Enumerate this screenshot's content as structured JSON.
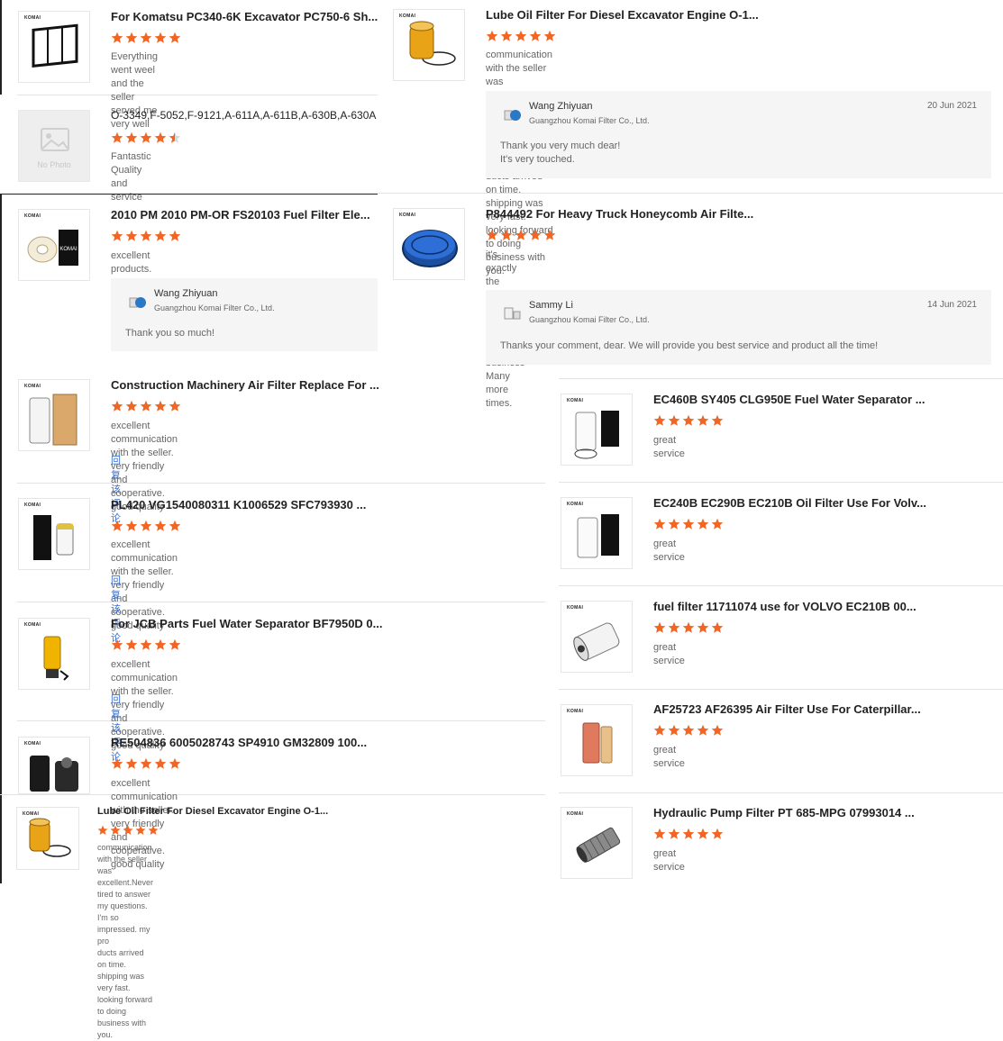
{
  "colors": {
    "star": "#f26522",
    "link": "#3a6fd0",
    "reply_bg": "#f5f5f5"
  },
  "brand_mark": "KOMAI",
  "reviews": [
    {
      "title": "For Komatsu PC340-6K Excavator PC750-6 Sh...",
      "rating": 5,
      "text": "Everything went weel and the seller served me very well",
      "thumb_icon": "cabin-air-filter-icon"
    },
    {
      "title": "Lube Oil Filter For Diesel Excavator Engine O-1...",
      "rating": 5,
      "text_lines": [
        "communication with the seller was excellent.Never tired to answer my questions. I'm so impressed. my pro",
        "ducts arrived on time. shipping was very fast. looking forward to doing business with you."
      ],
      "thumb_icon": "oil-filter-element-icon",
      "reply": {
        "name": "Wang Zhiyuan",
        "company": "Guangzhou Komai Filter Co., Ltd.",
        "date": "20 Jun 2021",
        "lines": [
          "Thank you very much dear!",
          "It's very touched."
        ]
      }
    },
    {
      "title": "O-3349,F-5052,F-9121,A-611A,A-611B,A-630B,A-630A",
      "rating": 4.5,
      "text": "Fantastic Quality and service",
      "thumb_icon": "no-photo-icon",
      "no_photo_label": "No Photo"
    },
    {
      "title": "2010 PM 2010 PM-OR FS20103 Fuel Filter Ele...",
      "rating": 5,
      "text": "excellent products.",
      "thumb_icon": "fuel-filter-icon",
      "reply": {
        "name": "Wang Zhiyuan",
        "company": "Guangzhou Komai Filter Co., Ltd.",
        "lines": [
          "Thank you so much!"
        ]
      }
    },
    {
      "title": "P844492 For Heavy Truck Honeycomb Air Filte...",
      "rating": 5,
      "text_lines": [
        "it's exactly the product I ordered.",
        "looking forward to doing business Many more times."
      ],
      "thumb_icon": "honeycomb-air-filter-icon",
      "reply": {
        "name": "Sammy Li",
        "company": "Guangzhou Komai Filter Co., Ltd.",
        "date": "14 Jun 2021",
        "lines": [
          "Thanks your comment, dear. We will provide you best service and product all the time!"
        ]
      }
    },
    {
      "title": "Construction Machinery Air Filter Replace For ...",
      "rating": 5,
      "text": "excellent communication with the seller. very friendly and cooperative.  good quality",
      "reply_link": "回复该评论",
      "thumb_icon": "air-filter-pair-icon"
    },
    {
      "title": "EC460B SY405 CLG950E Fuel Water Separator ...",
      "rating": 5,
      "text": "great service",
      "thumb_icon": "fuel-water-separator-icon"
    },
    {
      "title": "PL420 VG1540080311 K1006529 SFC793930 ...",
      "rating": 5,
      "text": "excellent communication with the seller. very friendly and cooperative.  good quality",
      "reply_link": "回复该评论",
      "thumb_icon": "fuel-filter-box-icon"
    },
    {
      "title": "EC240B EC290B EC210B Oil Filter Use For Volv...",
      "rating": 5,
      "text": "great service",
      "thumb_icon": "spin-on-oil-filter-icon"
    },
    {
      "title": "fuel filter 11711074 use for VOLVO EC210B 00...",
      "rating": 5,
      "text": "great service",
      "thumb_icon": "spin-on-fuel-filter-icon"
    },
    {
      "title": "For JCB Parts Fuel Water Separator BF7950D 0...",
      "rating": 5,
      "text": "excellent communication with the seller. very friendly and cooperative.  good quality",
      "reply_link": "回复该评论",
      "thumb_icon": "yellow-separator-icon"
    },
    {
      "title": "AF25723 AF26395 Air Filter Use For Caterpillar...",
      "rating": 5,
      "text": "great service",
      "thumb_icon": "round-air-filter-icon"
    },
    {
      "title": "RE504836 6005028743 SP4910 GM32809 100...",
      "rating": 5,
      "text": "excellent communication with the seller. very friendly and cooperative.  good quality",
      "thumb_icon": "black-oil-filter-icon"
    },
    {
      "title": "Lube Oil Filter For Diesel Excavator Engine O-1...",
      "rating": 5,
      "text_lines": [
        "communication with the seller was excellent.Never tired to answer my questions. I'm so impressed. my pro",
        "ducts arrived on time. shipping was very fast. looking forward to doing business with you."
      ],
      "thumb_icon": "oil-filter-element-icon"
    },
    {
      "title": "Hydraulic Pump Filter PT 685-MPG 07993014 ...",
      "rating": 5,
      "text": "great service",
      "thumb_icon": "hydraulic-filter-icon"
    }
  ]
}
